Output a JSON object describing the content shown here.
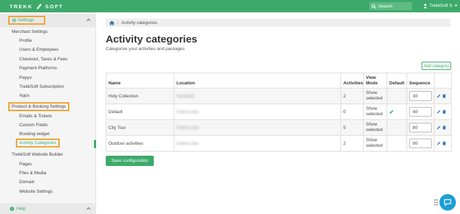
{
  "app": {
    "brand_left": "TREKK",
    "brand_right": "SOFT"
  },
  "topbar": {
    "search_label": "Search",
    "user_label": "TrekkSoft S."
  },
  "sidebar": {
    "settings_label": "Settings",
    "merchant_header": "Merchant Settings",
    "merchant_items": [
      "Profile",
      "Users & Employees",
      "Checkout, Taxes & Fees",
      "Payment Platforms",
      "Payyo",
      "TrekkSoft Subscription",
      "Apps"
    ],
    "product_header": "Product & Booking Settings",
    "product_items": [
      "Emails & Tickets",
      "Custom Fields",
      "Booking widget",
      "Activity Categories"
    ],
    "website_header": "TrekkSoft Website Builder",
    "website_items": [
      "Pages",
      "Files & Media",
      "Domain",
      "Website Settings"
    ],
    "help_label": "Help"
  },
  "breadcrumb": {
    "current": "Activity categories"
  },
  "page": {
    "title": "Activity categories",
    "subtitle": "Categorise your activities and packages",
    "add_button": "Add category",
    "save_button": "Save configuration"
  },
  "table": {
    "headers": [
      "Name",
      "Location",
      "Activities",
      "View Mode",
      "Default",
      "Sequence",
      ""
    ],
    "rows": [
      {
        "name": "Holy Collection",
        "location": "Hamilwer",
        "activities": "2",
        "view_mode": "Show selected",
        "default": "",
        "sequence": "30"
      },
      {
        "name": "Default",
        "location": "Dalma Oen",
        "activities": "0",
        "view_mode": "Show selected",
        "default": "✔",
        "sequence": "40"
      },
      {
        "name": "City Tour",
        "location": "Dalma Oen",
        "activities": "5",
        "view_mode": "Show selected",
        "default": "",
        "sequence": "80"
      },
      {
        "name": "Outdoor activities",
        "location": "Dalma Oen",
        "activities": "2",
        "view_mode": "Show selected",
        "default": "",
        "sequence": "90"
      }
    ]
  },
  "colors": {
    "brand_green": "#3daa6b",
    "highlight_orange": "#f0a330",
    "chat_blue": "#1e9ed6"
  },
  "icons": [
    "rocket-logo-icon",
    "search-icon",
    "user-icon",
    "gear-icon",
    "chevron-up-icon",
    "home-icon",
    "edit-icon",
    "trash-icon",
    "help-icon",
    "chat-icon",
    "grid-dots-icon"
  ]
}
